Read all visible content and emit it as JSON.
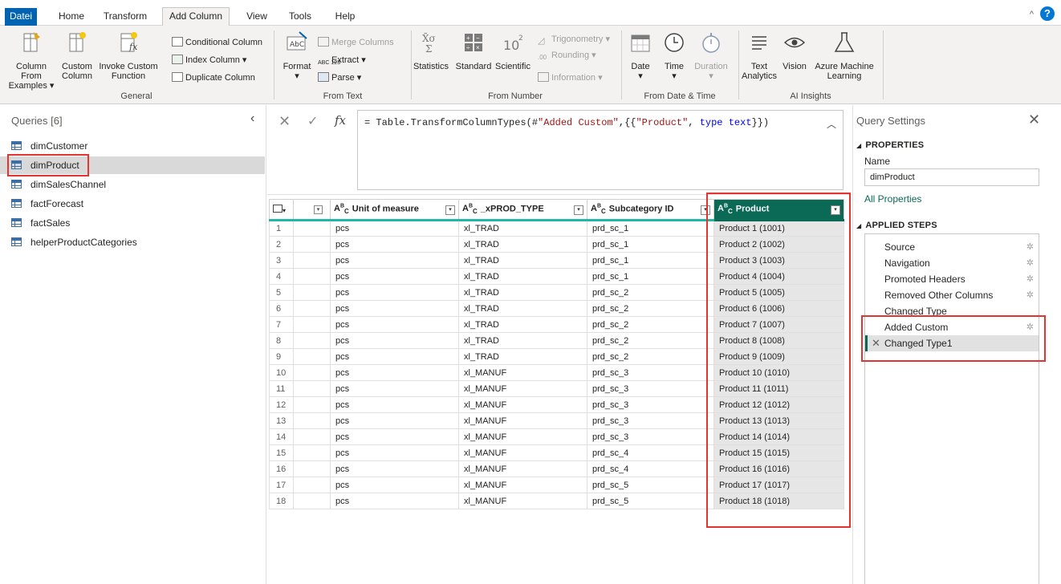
{
  "tabs": [
    "Datei",
    "Home",
    "Transform",
    "Add Column",
    "View",
    "Tools",
    "Help"
  ],
  "ribbon": {
    "general": {
      "title": "General",
      "column_from_examples": [
        "Column From",
        "Examples ▾"
      ],
      "custom_column": [
        "Custom",
        "Column"
      ],
      "invoke_custom_function": [
        "Invoke Custom",
        "Function"
      ],
      "conditional_column": "Conditional Column",
      "index_column": "Index Column ▾",
      "duplicate_column": "Duplicate Column"
    },
    "from_text": {
      "title": "From Text",
      "format": "Format",
      "merge_columns": "Merge Columns",
      "extract": "Extract ▾",
      "parse": "Parse ▾"
    },
    "from_number": {
      "title": "From Number",
      "statistics": "Statistics",
      "standard": "Standard",
      "scientific": "Scientific",
      "trigonometry": "Trigonometry",
      "rounding": "Rounding",
      "information": "Information"
    },
    "from_date_time": {
      "title": "From Date & Time",
      "date": "Date",
      "time": "Time",
      "duration": "Duration"
    },
    "ai_insights": {
      "title": "AI Insights",
      "text_analytics": [
        "Text",
        "Analytics"
      ],
      "vision": "Vision",
      "azure_ml": [
        "Azure Machine",
        "Learning"
      ]
    }
  },
  "queries": {
    "title": "Queries [6]",
    "items": [
      "dimCustomer",
      "dimProduct",
      "dimSalesChannel",
      "factForecast",
      "factSales",
      "helperProductCategories"
    ],
    "selected": "dimProduct"
  },
  "formula": {
    "prefix": "= Table.TransformColumnTypes(#",
    "s1": "\"Added Custom\"",
    "mid": ",{{",
    "s2": "\"Product\"",
    "comma": ", ",
    "kw": "type text",
    "suffix": "}})"
  },
  "grid": {
    "columns": [
      "Unit of measure",
      "_xPROD_TYPE",
      "Subcategory ID",
      "Product"
    ],
    "rows": [
      [
        "1",
        "pcs",
        "xl_TRAD",
        "prd_sc_1",
        "Product 1 (1001)"
      ],
      [
        "2",
        "pcs",
        "xl_TRAD",
        "prd_sc_1",
        "Product 2 (1002)"
      ],
      [
        "3",
        "pcs",
        "xl_TRAD",
        "prd_sc_1",
        "Product 3 (1003)"
      ],
      [
        "4",
        "pcs",
        "xl_TRAD",
        "prd_sc_1",
        "Product 4 (1004)"
      ],
      [
        "5",
        "pcs",
        "xl_TRAD",
        "prd_sc_2",
        "Product 5 (1005)"
      ],
      [
        "6",
        "pcs",
        "xl_TRAD",
        "prd_sc_2",
        "Product 6 (1006)"
      ],
      [
        "7",
        "pcs",
        "xl_TRAD",
        "prd_sc_2",
        "Product 7 (1007)"
      ],
      [
        "8",
        "pcs",
        "xl_TRAD",
        "prd_sc_2",
        "Product 8 (1008)"
      ],
      [
        "9",
        "pcs",
        "xl_TRAD",
        "prd_sc_2",
        "Product 9 (1009)"
      ],
      [
        "10",
        "pcs",
        "xl_MANUF",
        "prd_sc_3",
        "Product 10 (1010)"
      ],
      [
        "11",
        "pcs",
        "xl_MANUF",
        "prd_sc_3",
        "Product 11 (1011)"
      ],
      [
        "12",
        "pcs",
        "xl_MANUF",
        "prd_sc_3",
        "Product 12 (1012)"
      ],
      [
        "13",
        "pcs",
        "xl_MANUF",
        "prd_sc_3",
        "Product 13 (1013)"
      ],
      [
        "14",
        "pcs",
        "xl_MANUF",
        "prd_sc_3",
        "Product 14 (1014)"
      ],
      [
        "15",
        "pcs",
        "xl_MANUF",
        "prd_sc_4",
        "Product 15 (1015)"
      ],
      [
        "16",
        "pcs",
        "xl_MANUF",
        "prd_sc_4",
        "Product 16 (1016)"
      ],
      [
        "17",
        "pcs",
        "xl_MANUF",
        "prd_sc_5",
        "Product 17 (1017)"
      ],
      [
        "18",
        "pcs",
        "xl_MANUF",
        "prd_sc_5",
        "Product 18 (1018)"
      ]
    ]
  },
  "settings": {
    "title": "Query Settings",
    "properties": "PROPERTIES",
    "name_label": "Name",
    "name_value": "dimProduct",
    "all_properties": "All Properties",
    "applied_steps": "APPLIED STEPS",
    "steps": [
      {
        "label": "Source",
        "gear": true
      },
      {
        "label": "Navigation",
        "gear": true
      },
      {
        "label": "Promoted Headers",
        "gear": true
      },
      {
        "label": "Removed Other Columns",
        "gear": true
      },
      {
        "label": "Changed Type",
        "gear": false
      },
      {
        "label": "Added Custom",
        "gear": true
      },
      {
        "label": "Changed Type1",
        "gear": false
      }
    ]
  },
  "colors": {
    "accent": "#0b6a55",
    "file_tab": "#0063b1",
    "highlight": "#e3342f",
    "header_underline": "#23b5a5"
  }
}
